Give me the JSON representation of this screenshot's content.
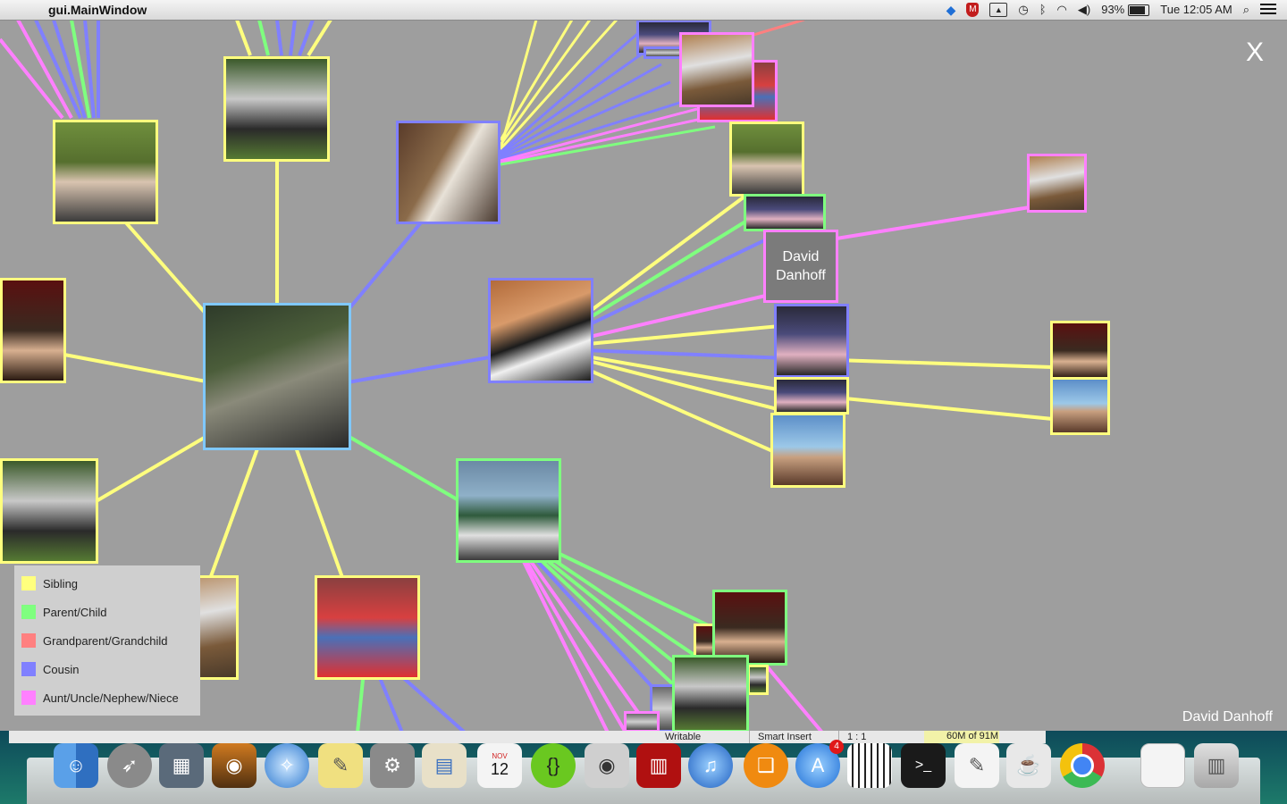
{
  "menubar": {
    "apple_symbol": "",
    "app_name": "gui.MainWindow",
    "battery": "93%",
    "clock": "Tue 12:05 AM",
    "icons": [
      "dropbox-icon",
      "shield-icon",
      "airplay-icon",
      "time-machine-icon",
      "bluetooth-icon",
      "wifi-icon",
      "volume-icon",
      "battery-icon",
      "spotlight-icon",
      "notification-list-icon"
    ]
  },
  "graph": {
    "close_label": "X",
    "selected_name": "David Danhoff",
    "hover_label": "David Danhoff"
  },
  "legend": {
    "items": [
      {
        "label": "Sibling",
        "color": "#ffff7e"
      },
      {
        "label": "Parent/Child",
        "color": "#7fff7f"
      },
      {
        "label": "Grandparent/Grandchild",
        "color": "#ff8080"
      },
      {
        "label": "Cousin",
        "color": "#8080ff"
      },
      {
        "label": "Aunt/Uncle/Nephew/Niece",
        "color": "#ff80ff"
      }
    ]
  },
  "editor_status": {
    "mode": "Writable",
    "insert": "Smart Insert",
    "position": "1 : 1",
    "memory": "60M of 91M"
  },
  "dock": {
    "items": [
      {
        "name": "finder-icon",
        "glyph": "☺"
      },
      {
        "name": "launchpad-icon",
        "glyph": "🚀"
      },
      {
        "name": "photo-browser-icon",
        "glyph": "▦"
      },
      {
        "name": "iphoto-icon",
        "glyph": "📷"
      },
      {
        "name": "safari-icon",
        "glyph": "✧"
      },
      {
        "name": "stickies-icon",
        "glyph": "✎"
      },
      {
        "name": "system-preferences-icon",
        "glyph": "⚙"
      },
      {
        "name": "preview-icon",
        "glyph": "▤"
      },
      {
        "name": "calendar-icon",
        "glyph": "12"
      },
      {
        "name": "code-editor-icon",
        "glyph": "{}"
      },
      {
        "name": "facetime-icon",
        "glyph": "◉"
      },
      {
        "name": "photo-booth-icon",
        "glyph": "▥"
      },
      {
        "name": "itunes-icon",
        "glyph": "♫"
      },
      {
        "name": "ibooks-icon",
        "glyph": "📖"
      },
      {
        "name": "app-store-icon",
        "glyph": "A"
      },
      {
        "name": "garageband-icon",
        "glyph": "▥"
      },
      {
        "name": "terminal-icon",
        "glyph": ">_"
      },
      {
        "name": "textedit-icon",
        "glyph": "✎"
      },
      {
        "name": "script-editor-icon",
        "glyph": "☕"
      },
      {
        "name": "chrome-icon",
        "glyph": "◎"
      },
      {
        "name": "documents-stack-icon",
        "glyph": "▯"
      },
      {
        "name": "trash-icon",
        "glyph": "🗑"
      }
    ],
    "app_store_badge": "4",
    "calendar_month": "NOV",
    "calendar_day": "12"
  }
}
